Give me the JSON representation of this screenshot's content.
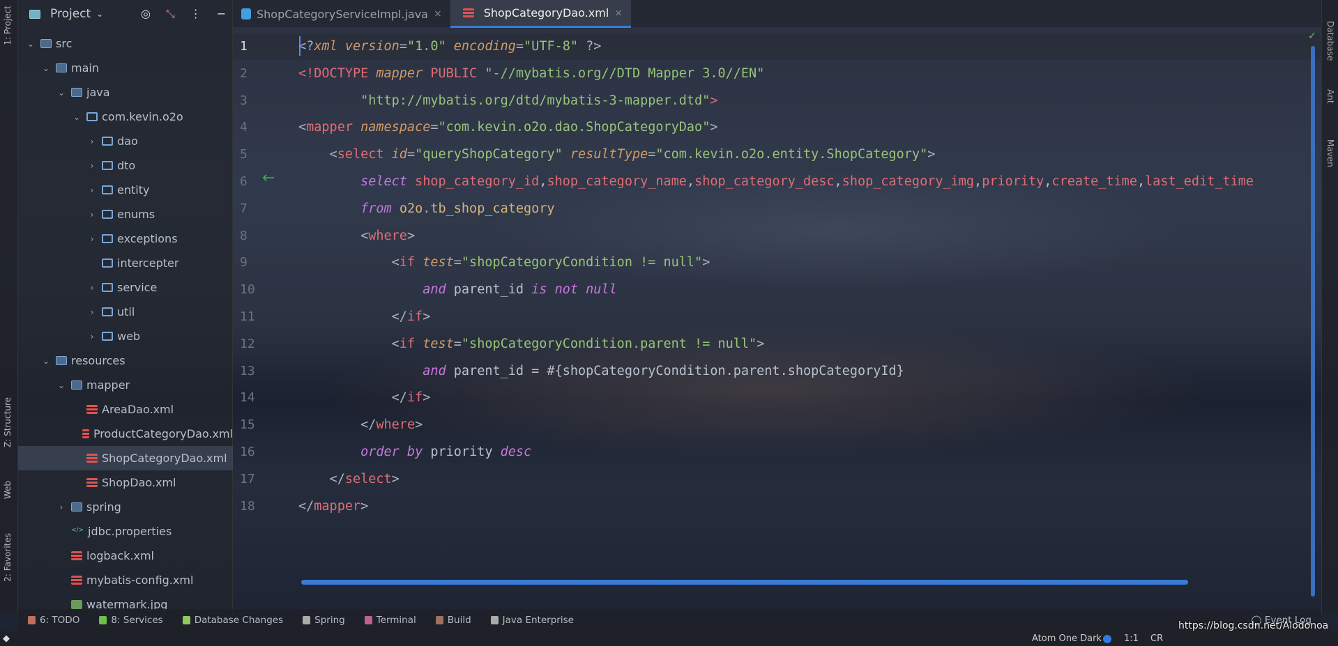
{
  "left_stripe": [
    "1: Project",
    "Z: Structure",
    "Web",
    "2: Favorites"
  ],
  "right_stripe": [
    "Database",
    "Ant",
    "Maven"
  ],
  "project_panel": {
    "title": "Project",
    "tree": [
      {
        "label": "src",
        "depth": 0,
        "open": true,
        "icon": "folder-src"
      },
      {
        "label": "main",
        "depth": 1,
        "open": true,
        "icon": "folder"
      },
      {
        "label": "java",
        "depth": 2,
        "open": true,
        "icon": "folder-source"
      },
      {
        "label": "com.kevin.o2o",
        "depth": 3,
        "open": true,
        "icon": "package"
      },
      {
        "label": "dao",
        "depth": 4,
        "open": false,
        "icon": "package"
      },
      {
        "label": "dto",
        "depth": 4,
        "open": false,
        "icon": "package"
      },
      {
        "label": "entity",
        "depth": 4,
        "open": false,
        "icon": "package"
      },
      {
        "label": "enums",
        "depth": 4,
        "open": false,
        "icon": "package"
      },
      {
        "label": "exceptions",
        "depth": 4,
        "open": false,
        "icon": "package"
      },
      {
        "label": "intercepter",
        "depth": 4,
        "open": null,
        "icon": "package"
      },
      {
        "label": "service",
        "depth": 4,
        "open": false,
        "icon": "package"
      },
      {
        "label": "util",
        "depth": 4,
        "open": false,
        "icon": "package"
      },
      {
        "label": "web",
        "depth": 4,
        "open": false,
        "icon": "package"
      },
      {
        "label": "resources",
        "depth": 1,
        "open": true,
        "icon": "folder-resources"
      },
      {
        "label": "mapper",
        "depth": 2,
        "open": true,
        "icon": "folder"
      },
      {
        "label": "AreaDao.xml",
        "depth": 3,
        "icon": "xml"
      },
      {
        "label": "ProductCategoryDao.xml",
        "depth": 3,
        "icon": "xml"
      },
      {
        "label": "ShopCategoryDao.xml",
        "depth": 3,
        "icon": "xml",
        "selected": true
      },
      {
        "label": "ShopDao.xml",
        "depth": 3,
        "icon": "xml"
      },
      {
        "label": "spring",
        "depth": 2,
        "open": false,
        "icon": "folder"
      },
      {
        "label": "jdbc.properties",
        "depth": 2,
        "icon": "properties"
      },
      {
        "label": "logback.xml",
        "depth": 2,
        "icon": "xml"
      },
      {
        "label": "mybatis-config.xml",
        "depth": 2,
        "icon": "xml"
      },
      {
        "label": "watermark.jpg",
        "depth": 2,
        "icon": "image"
      }
    ]
  },
  "tabs": [
    {
      "label": "ShopCategoryServiceImpl.java",
      "active": false
    },
    {
      "label": "ShopCategoryDao.xml",
      "active": true
    }
  ],
  "editor": {
    "current_line": 1,
    "lines": [
      [
        [
          "p",
          "<?"
        ],
        [
          "a",
          "xml"
        ],
        [
          "p",
          " "
        ],
        [
          "a",
          "version"
        ],
        [
          "p",
          "="
        ],
        [
          "s",
          "\"1.0\""
        ],
        [
          "p",
          " "
        ],
        [
          "a",
          "encoding"
        ],
        [
          "p",
          "="
        ],
        [
          "s",
          "\"UTF-8\""
        ],
        [
          "p",
          " ?>"
        ]
      ],
      [
        [
          "t",
          "<!DOCTYPE "
        ],
        [
          "a",
          "mapper"
        ],
        [
          "t",
          " PUBLIC "
        ],
        [
          "s",
          "\"-//mybatis.org//DTD Mapper 3.0//EN\""
        ]
      ],
      [
        [
          "p",
          "        "
        ],
        [
          "s",
          "\"http://mybatis.org/dtd/mybatis-3-mapper.dtd\""
        ],
        [
          "t",
          ">"
        ]
      ],
      [
        [
          "p",
          "<"
        ],
        [
          "t",
          "mapper "
        ],
        [
          "a",
          "namespace"
        ],
        [
          "p",
          "="
        ],
        [
          "s",
          "\"com.kevin.o2o.dao.ShopCategoryDao\""
        ],
        [
          "p",
          ">"
        ]
      ],
      [
        [
          "p",
          "    <"
        ],
        [
          "t",
          "select "
        ],
        [
          "a",
          "id"
        ],
        [
          "p",
          "="
        ],
        [
          "s",
          "\"queryShopCategory\""
        ],
        [
          "p",
          " "
        ],
        [
          "a",
          "resultType"
        ],
        [
          "p",
          "="
        ],
        [
          "s",
          "\"com.kevin.o2o.entity.ShopCategory\""
        ],
        [
          "p",
          ">"
        ]
      ],
      [
        [
          "p",
          "        "
        ],
        [
          "k",
          "select"
        ],
        [
          "p",
          " "
        ],
        [
          "t",
          "shop_category_id"
        ],
        [
          "d",
          ","
        ],
        [
          "t",
          "shop_category_name"
        ],
        [
          "d",
          ","
        ],
        [
          "t",
          "shop_category_desc"
        ],
        [
          "d",
          ","
        ],
        [
          "t",
          "shop_category_img"
        ],
        [
          "d",
          ","
        ],
        [
          "t",
          "priority"
        ],
        [
          "d",
          ","
        ],
        [
          "t",
          "create_time"
        ],
        [
          "d",
          ","
        ],
        [
          "t",
          "last_edit_time"
        ]
      ],
      [
        [
          "p",
          "        "
        ],
        [
          "k",
          "from"
        ],
        [
          "p",
          " "
        ],
        [
          "a2",
          "o2o.tb_shop_category"
        ]
      ],
      [
        [
          "p",
          "        <"
        ],
        [
          "t",
          "where"
        ],
        [
          "p",
          ">"
        ]
      ],
      [
        [
          "p",
          "            <"
        ],
        [
          "t",
          "if "
        ],
        [
          "a",
          "test"
        ],
        [
          "p",
          "="
        ],
        [
          "s",
          "\"shopCategoryCondition != null\""
        ],
        [
          "p",
          ">"
        ]
      ],
      [
        [
          "p",
          "                "
        ],
        [
          "k",
          "and"
        ],
        [
          "d",
          " parent_id "
        ],
        [
          "k",
          "is not null"
        ]
      ],
      [
        [
          "p",
          "            </"
        ],
        [
          "t",
          "if"
        ],
        [
          "p",
          ">"
        ]
      ],
      [
        [
          "p",
          "            <"
        ],
        [
          "t",
          "if "
        ],
        [
          "a",
          "test"
        ],
        [
          "p",
          "="
        ],
        [
          "s",
          "\"shopCategoryCondition.parent != null\""
        ],
        [
          "p",
          ">"
        ]
      ],
      [
        [
          "p",
          "                "
        ],
        [
          "k",
          "and"
        ],
        [
          "d",
          " parent_id = #{shopCategoryCondition.parent.shopCategoryId}"
        ]
      ],
      [
        [
          "p",
          "            </"
        ],
        [
          "t",
          "if"
        ],
        [
          "p",
          ">"
        ]
      ],
      [
        [
          "p",
          "        </"
        ],
        [
          "t",
          "where"
        ],
        [
          "p",
          ">"
        ]
      ],
      [
        [
          "p",
          "        "
        ],
        [
          "k",
          "order by"
        ],
        [
          "d",
          " priority "
        ],
        [
          "k",
          "desc"
        ]
      ],
      [
        [
          "p",
          "    </"
        ],
        [
          "t",
          "select"
        ],
        [
          "p",
          ">"
        ]
      ],
      [
        [
          "p",
          "</"
        ],
        [
          "t",
          "mapper"
        ],
        [
          "p",
          ">"
        ]
      ]
    ]
  },
  "bottom_toolbar": [
    {
      "label": "6: TODO",
      "color": "#c0705a"
    },
    {
      "label": "8: Services",
      "color": "#6fbf4a"
    },
    {
      "label": "Database Changes",
      "color": "#8fc860"
    },
    {
      "label": "Spring",
      "color": "#aaaaaa"
    },
    {
      "label": "Terminal",
      "color": "#c06090"
    },
    {
      "label": "Build",
      "color": "#a07060"
    },
    {
      "label": "Java Enterprise",
      "color": "#aaaaaa"
    }
  ],
  "event_log": "Event Log",
  "status": {
    "theme": "Atom One Dark",
    "position": "1:1",
    "line_sep": "CR",
    "watermark": "https://blog.csdn.net/Alodonoa"
  }
}
